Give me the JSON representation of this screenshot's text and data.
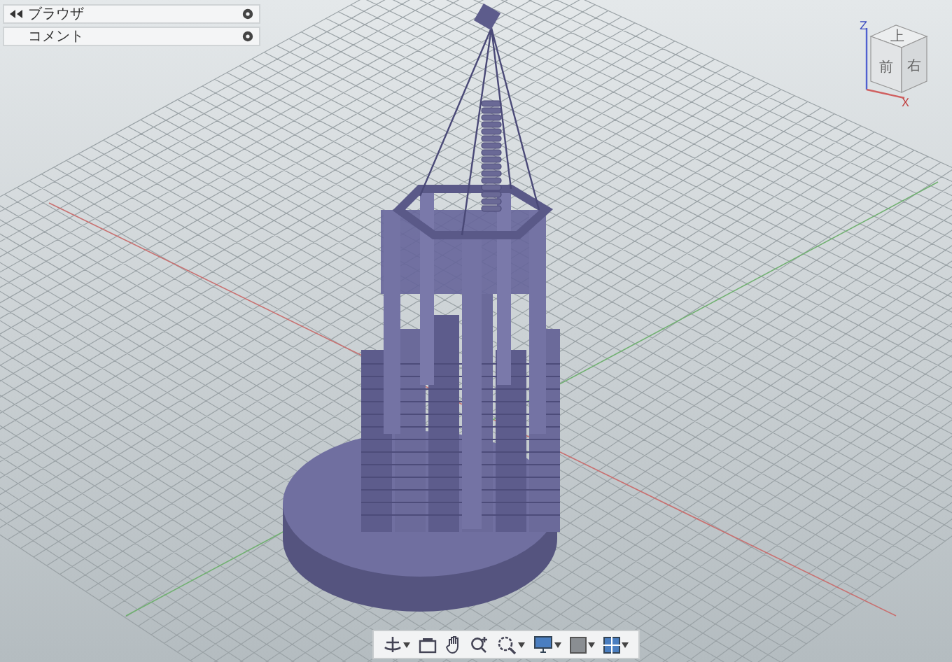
{
  "browser_panels": [
    {
      "label": "ブラウザ",
      "kind": "collapse"
    },
    {
      "label": "コメント",
      "kind": "plain"
    }
  ],
  "view_cube": {
    "top": "上",
    "front": "前",
    "right": "右",
    "axis_z": "Z",
    "axis_x": "X"
  }
}
